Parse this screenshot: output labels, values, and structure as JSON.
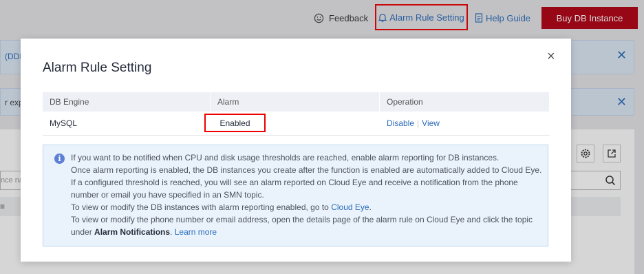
{
  "header": {
    "feedback": "Feedback",
    "alarm_rule_setting": "Alarm Rule Setting",
    "help_guide": "Help Guide",
    "buy_button": "Buy DB Instance"
  },
  "background": {
    "banner1_text": "(DDI",
    "banner2_text": "r expe",
    "search_placeholder": "nce na"
  },
  "modal": {
    "title": "Alarm Rule Setting",
    "close_glyph": "×",
    "table": {
      "columns": [
        "DB Engine",
        "Alarm",
        "Operation"
      ],
      "rows": [
        {
          "engine": "MySQL",
          "alarm": "Enabled",
          "op_disable": "Disable",
          "op_view": "View"
        }
      ]
    },
    "info": {
      "line1": "If you want to be notified when CPU and disk usage thresholds are reached, enable alarm reporting for DB instances.",
      "line2": "Once alarm reporting is enabled, the DB instances you create after the function is enabled are automatically added to Cloud Eye. If a configured threshold is reached, you will see an alarm reported on Cloud Eye and receive a notification from the phone number or email you have specified in an SMN topic.",
      "line3_prefix": "To view or modify the DB instances with alarm reporting enabled, go to ",
      "line3_link": "Cloud Eye",
      "line3_suffix": ".",
      "line4_prefix": "To view or modify the phone number or email address, open the details page of the alarm rule on Cloud Eye and click the topic under ",
      "line4_bold": "Alarm Notifications",
      "line4_suffix": ". ",
      "learn_more": "Learn more"
    }
  },
  "colors": {
    "brand_red": "#b00012",
    "link_blue": "#2a6bb8",
    "highlight_red": "#e00000",
    "info_bg": "#eaf3fc"
  }
}
